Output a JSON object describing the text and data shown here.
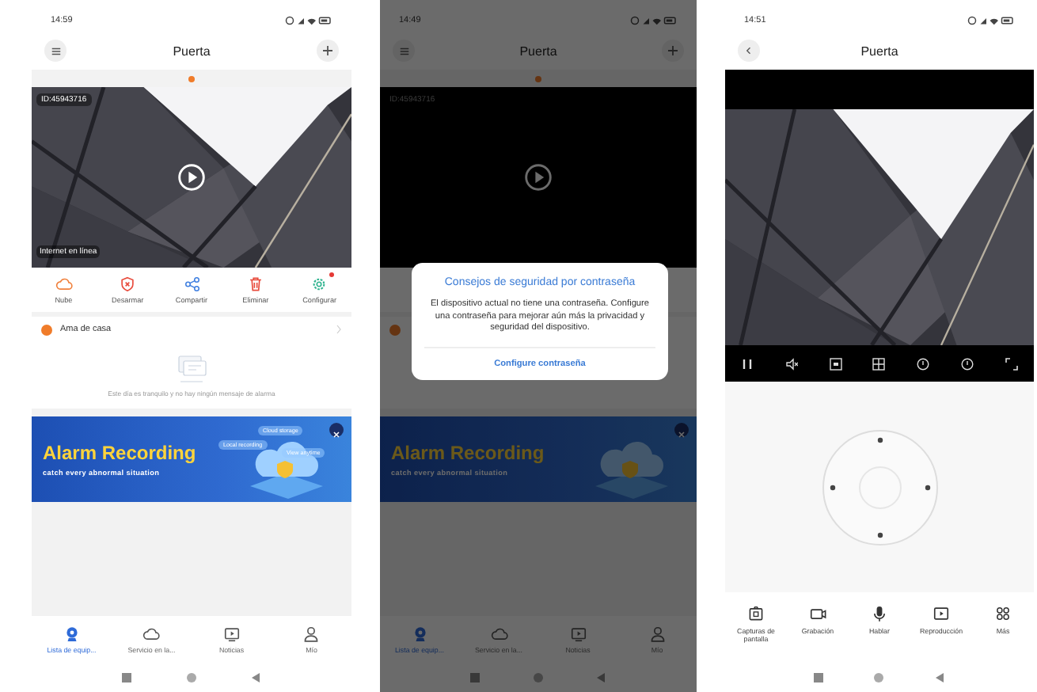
{
  "home_screen": {
    "status_time": "14:59",
    "title": "Puerta",
    "camera": {
      "id": "ID:45943716",
      "connection": "Internet en línea"
    },
    "actions": [
      {
        "label": "Nube",
        "kind": "cloud",
        "badge": false
      },
      {
        "label": "Desarmar",
        "kind": "disarm",
        "badge": false
      },
      {
        "label": "Compartir",
        "kind": "share",
        "badge": false
      },
      {
        "label": "Eliminar",
        "kind": "delete",
        "badge": false
      },
      {
        "label": "Configurar",
        "kind": "settings",
        "badge": true
      }
    ],
    "alarm_mode": "Ama de casa",
    "empty_message": "Este día es tranquilo y no hay ningún mensaje de alarma",
    "banner": {
      "title": "Alarm Recording",
      "subtitle": "catch every abnormal situation",
      "tags": [
        "Local recording",
        "Cloud storage",
        "View anytime"
      ]
    },
    "nav": [
      {
        "label": "Lista de equip...",
        "kind": "devices",
        "selected": true
      },
      {
        "label": "Servicio en la...",
        "kind": "cloud",
        "selected": false
      },
      {
        "label": "Noticias",
        "kind": "news",
        "selected": false
      },
      {
        "label": "Mío",
        "kind": "profile",
        "selected": false
      }
    ]
  },
  "dialog_screen": {
    "status_time": "14:49",
    "title": "Puerta",
    "dimmed": true,
    "camera": {
      "id": "ID:45943716"
    },
    "banner": {
      "title": "Alarm Recording",
      "subtitle": "catch every abnormal situation"
    },
    "nav": [
      {
        "label": "Lista de equip...",
        "kind": "devices",
        "selected": true
      },
      {
        "label": "Servicio en la...",
        "kind": "cloud",
        "selected": false
      },
      {
        "label": "Noticias",
        "kind": "news",
        "selected": false
      },
      {
        "label": "Mío",
        "kind": "profile",
        "selected": false
      }
    ],
    "dialog": {
      "title": "Consejos de seguridad por contraseña",
      "message": "El dispositivo actual no tiene una contraseña. Configure una contraseña para mejorar aún más la privacidad y seguridad del dispositivo.",
      "action": "Configure contraseña"
    }
  },
  "live_screen": {
    "status_time": "14:51",
    "title": "Puerta",
    "actions": [
      {
        "label": "Capturas de pantalla",
        "kind": "screenshot"
      },
      {
        "label": "Grabación",
        "kind": "record"
      },
      {
        "label": "Hablar",
        "kind": "talk"
      },
      {
        "label": "Reproducción",
        "kind": "playback"
      },
      {
        "label": "Más",
        "kind": "more"
      }
    ]
  }
}
